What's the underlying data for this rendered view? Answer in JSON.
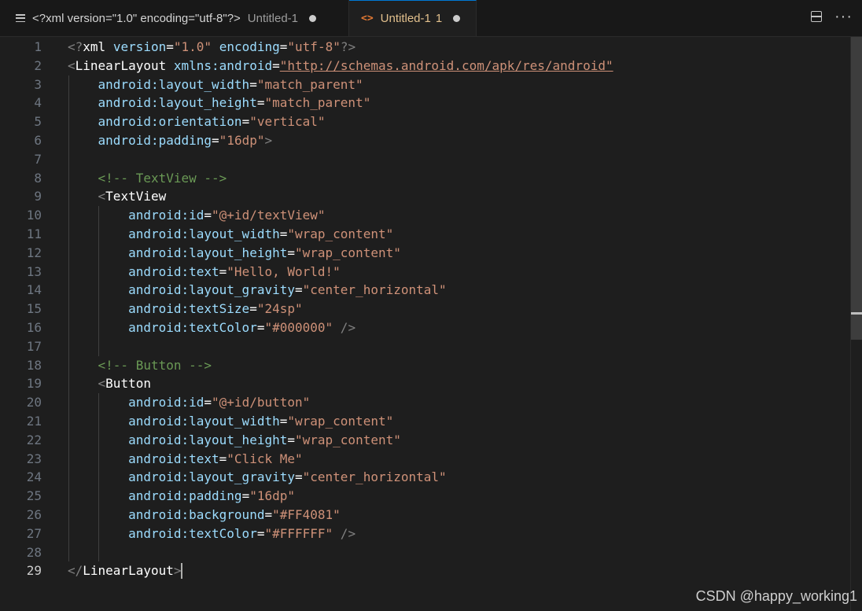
{
  "tabs": [
    {
      "label": "<?xml version=\"1.0\" encoding=\"utf-8\"?>",
      "description": "Untitled-1",
      "icon": "lines-icon",
      "modified": true
    },
    {
      "label": "Untitled-1",
      "problems": "1",
      "icon": "xml-icon",
      "modified": true,
      "active": true
    }
  ],
  "editor": {
    "active_line": 29,
    "lines": [
      {
        "n": "1"
      },
      {
        "n": "2"
      },
      {
        "n": "3"
      },
      {
        "n": "4"
      },
      {
        "n": "5"
      },
      {
        "n": "6"
      },
      {
        "n": "7"
      },
      {
        "n": "8"
      },
      {
        "n": "9"
      },
      {
        "n": "10"
      },
      {
        "n": "11"
      },
      {
        "n": "12"
      },
      {
        "n": "13"
      },
      {
        "n": "14"
      },
      {
        "n": "15"
      },
      {
        "n": "16"
      },
      {
        "n": "17"
      },
      {
        "n": "18"
      },
      {
        "n": "19"
      },
      {
        "n": "20"
      },
      {
        "n": "21"
      },
      {
        "n": "22"
      },
      {
        "n": "23"
      },
      {
        "n": "24"
      },
      {
        "n": "25"
      },
      {
        "n": "26"
      },
      {
        "n": "27"
      },
      {
        "n": "28"
      },
      {
        "n": "29"
      }
    ],
    "code": [
      "<?xml version=\"1.0\" encoding=\"utf-8\"?>",
      "<LinearLayout xmlns:android=\"http://schemas.android.com/apk/res/android\"",
      "    android:layout_width=\"match_parent\"",
      "    android:layout_height=\"match_parent\"",
      "    android:orientation=\"vertical\"",
      "    android:padding=\"16dp\">",
      "",
      "    <!-- TextView -->",
      "    <TextView",
      "        android:id=\"@+id/textView\"",
      "        android:layout_width=\"wrap_content\"",
      "        android:layout_height=\"wrap_content\"",
      "        android:text=\"Hello, World!\"",
      "        android:layout_gravity=\"center_horizontal\"",
      "        android:textSize=\"24sp\"",
      "        android:textColor=\"#000000\" />",
      "",
      "    <!-- Button -->",
      "    <Button",
      "        android:id=\"@+id/button\"",
      "        android:layout_width=\"wrap_content\"",
      "        android:layout_height=\"wrap_content\"",
      "        android:text=\"Click Me\"",
      "        android:layout_gravity=\"center_horizontal\"",
      "        android:padding=\"16dp\"",
      "        android:background=\"#FF4081\"",
      "        android:textColor=\"#FFFFFF\" />",
      "",
      "</LinearLayout>"
    ]
  },
  "watermark": "CSDN @happy_working1",
  "colors": {
    "tag": "#ffffff",
    "bracket": "#808080",
    "attribute": "#9cdcfe",
    "string": "#ce9178",
    "comment": "#6a9955",
    "modified_tab": "#e2c08d"
  }
}
